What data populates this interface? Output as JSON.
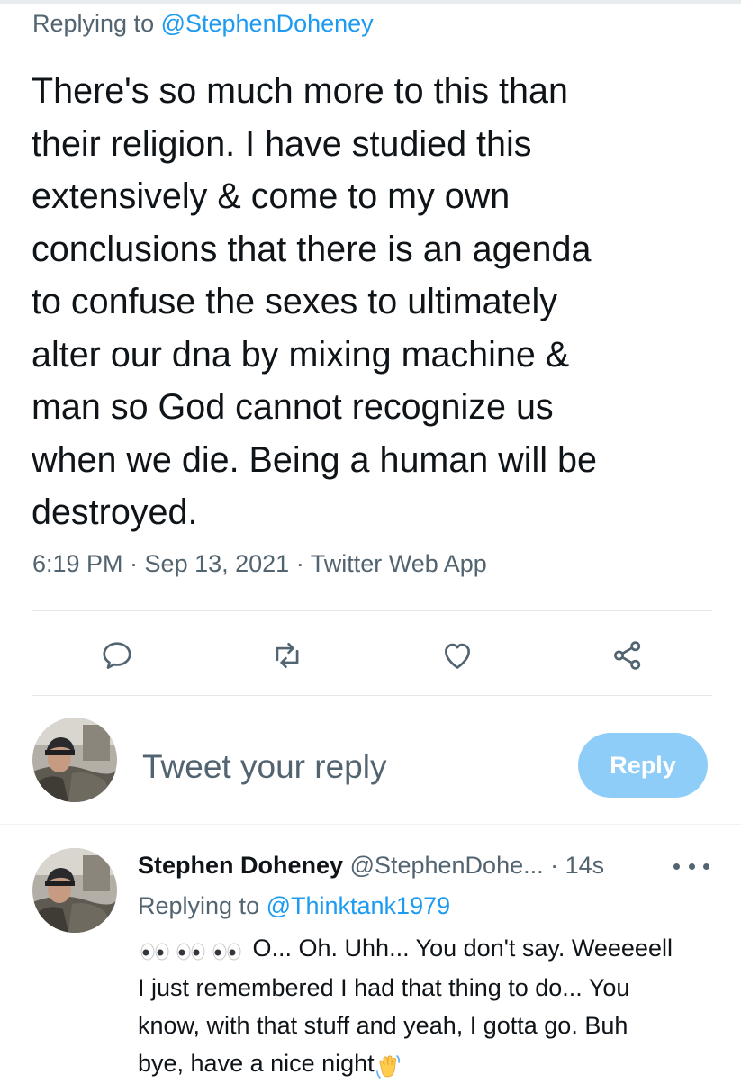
{
  "tweet": {
    "replying_prefix": "Replying to ",
    "replying_handle": "@StephenDoheney",
    "text_lines": [
      "There's so much more to this than",
      "their religion. I have studied this",
      "extensively & come to my own",
      "conclusions that there is an agenda",
      "to confuse the sexes to ultimately",
      "alter our dna by mixing machine &",
      "man so God cannot recognize us",
      "when we die. Being a human will be",
      "destroyed."
    ],
    "meta": "6:19 PM · Sep 13, 2021 · Twitter Web App"
  },
  "actions": {
    "reply_icon": "reply-icon",
    "retweet_icon": "retweet-icon",
    "like_icon": "heart-icon",
    "share_icon": "share-icon"
  },
  "composer": {
    "placeholder": "Tweet your reply",
    "button_label": "Reply"
  },
  "reply": {
    "name": "Stephen Doheney",
    "handle": "@StephenDohe...",
    "separator": " · ",
    "time": "14s",
    "replying_prefix": "Replying to ",
    "replying_handle": "@Thinktank1979",
    "body_first": "O... Oh. Uhh... You don't say. Weeeeell",
    "body_lines": [
      "I just remembered I had that thing to do... You",
      "know, with that stuff and yeah, I gotta go. Buh"
    ],
    "body_last": "bye, have a nice night",
    "emoji_leading": "eyes-emoji x3",
    "emoji_trailing": "waving-hand-emoji"
  },
  "colors": {
    "text": "#0f1419",
    "secondary": "#536471",
    "link": "#1d9bf0",
    "reply_button_disabled": "#8ecdf7",
    "divider": "#e3e8ec"
  }
}
